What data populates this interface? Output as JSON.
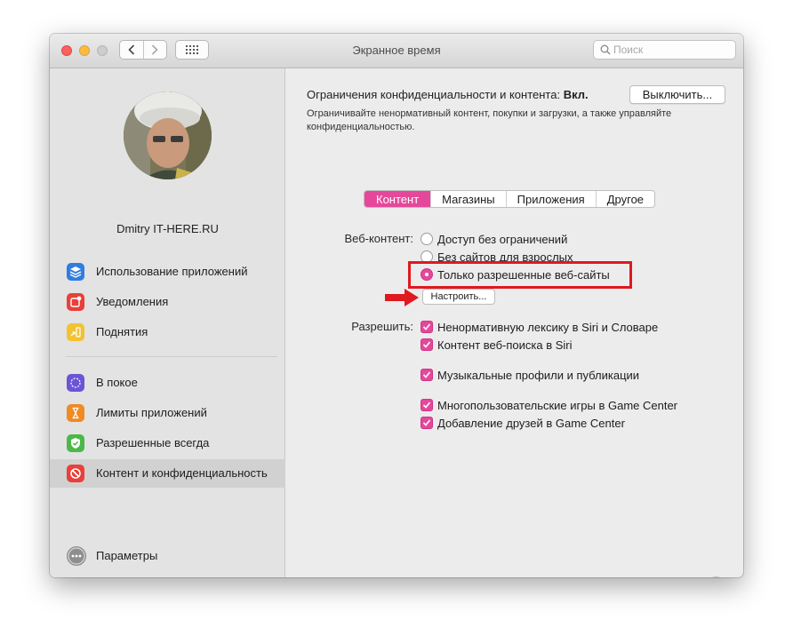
{
  "window": {
    "title": "Экранное время"
  },
  "search": {
    "placeholder": "Поиск"
  },
  "user": {
    "name": "Dmitry IT-HERE.RU"
  },
  "sidebar": {
    "items": [
      {
        "label": "Использование приложений",
        "icon": "layers-icon",
        "color": "#2f7de1"
      },
      {
        "label": "Уведомления",
        "icon": "notification-badge-icon",
        "color": "#e8403a"
      },
      {
        "label": "Поднятия",
        "icon": "pickup-arrow-icon",
        "color": "#f2c230"
      },
      {
        "label": "В покое",
        "icon": "downtime-moon-icon",
        "color": "#6c54d6"
      },
      {
        "label": "Лимиты приложений",
        "icon": "hourglass-icon",
        "color": "#f08a24"
      },
      {
        "label": "Разрешенные всегда",
        "icon": "checkmark-shield-icon",
        "color": "#4cb848"
      },
      {
        "label": "Контент и конфиденциальность",
        "icon": "restriction-icon",
        "color": "#e8403a"
      }
    ],
    "settings_label": "Параметры"
  },
  "restrictions": {
    "title_prefix": "Ограничения конфиденциальности и контента:",
    "status": "Вкл.",
    "off_button": "Выключить...",
    "description": "Ограничивайте ненормативный контент, покупки и загрузки, а также управляйте конфиденциальностью."
  },
  "tabs": [
    "Контент",
    "Магазины",
    "Приложения",
    "Другое"
  ],
  "web_content": {
    "label": "Веб-контент:",
    "options": [
      "Доступ без ограничений",
      "Без сайтов для взрослых",
      "Только разрешенные веб-сайты"
    ],
    "configure_button": "Настроить..."
  },
  "allow": {
    "label": "Разрешить:",
    "items": [
      "Ненормативную лексику в Siri и Словаре",
      "Контент веб-поиска в Siri",
      "Музыкальные профили и публикации",
      "Многопользовательские игры в Game Center",
      "Добавление друзей в Game Center"
    ]
  },
  "help": {
    "label": "?"
  },
  "colors": {
    "accent": "#e5489a",
    "annotation": "#e0181f"
  }
}
